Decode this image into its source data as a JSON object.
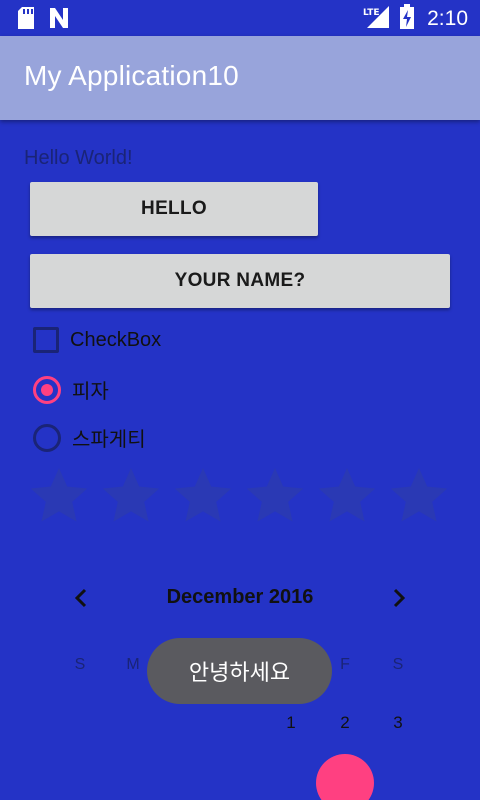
{
  "status_bar": {
    "time": "2:10",
    "icons": [
      "sd-card-icon",
      "n-notification-icon",
      "lte-signal-icon",
      "battery-icon"
    ],
    "lte_label": "LTE"
  },
  "app_bar": {
    "title": "My Application10"
  },
  "main": {
    "hello_text": "Hello World!",
    "hello_button": "HELLO",
    "name_button": "YOUR NAME?",
    "checkbox_label": "CheckBox",
    "radio_options": [
      {
        "label": "피자",
        "selected": true
      },
      {
        "label": "스파게티",
        "selected": false
      }
    ],
    "rating": {
      "stars": 6,
      "value": 0
    }
  },
  "calendar": {
    "month_label": "December 2016",
    "weekdays_visible": [
      "S",
      "M",
      "F",
      "S"
    ],
    "days_visible": [
      "1",
      "2",
      "3"
    ]
  },
  "toast": {
    "text": "안녕하세요"
  },
  "colors": {
    "background": "#2433c6",
    "app_bar": "#98a4db",
    "accent": "#ff4081",
    "button": "#d6d7d7",
    "toast": "#5a5a5f"
  }
}
